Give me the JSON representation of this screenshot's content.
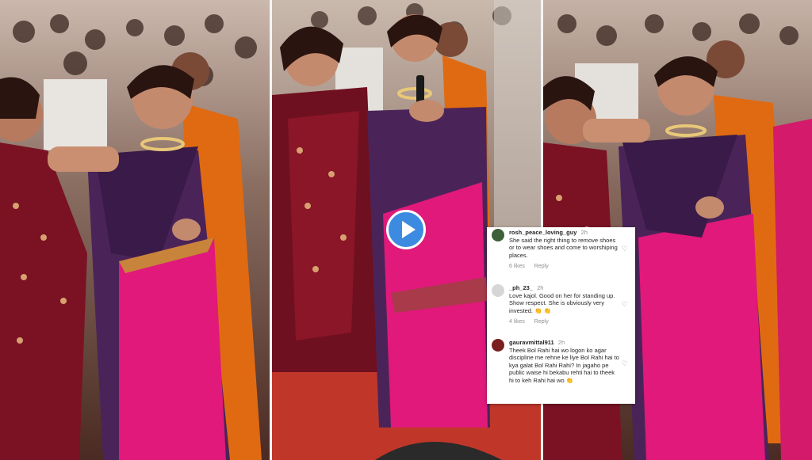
{
  "player": {
    "play_icon": "play-icon",
    "accent_color": "#3d8be0"
  },
  "comments": [
    {
      "username": "rosh_peace_loving_guy",
      "time": "2h",
      "text": "She said the right thing to remove shoes or to wear shoes and come to worshiping places.",
      "likes": "6 likes",
      "reply": "Reply",
      "avatar_color": "#3f5e3a"
    },
    {
      "username": "_ph_23_",
      "time": "2h",
      "text": "Love kajol. Good on her for standing up. Show respect. She is obviously very invested.",
      "emoji": "👏 👏",
      "likes": "4 likes",
      "reply": "Reply",
      "avatar_color": "#d6d6d6"
    },
    {
      "username": "gauravmittal911",
      "time": "2h",
      "text": "Theek Bol Rahi hai wo logon ko agar discipline me rehne ke liye Bol Rahi hai to kya galat Bol Rahi Rahi? In jagaho pe public waise hi bekabu rehti hai to theek hi to keh Rahi hai wo",
      "emoji": "👏",
      "avatar_color": "#7a1e1e"
    }
  ]
}
